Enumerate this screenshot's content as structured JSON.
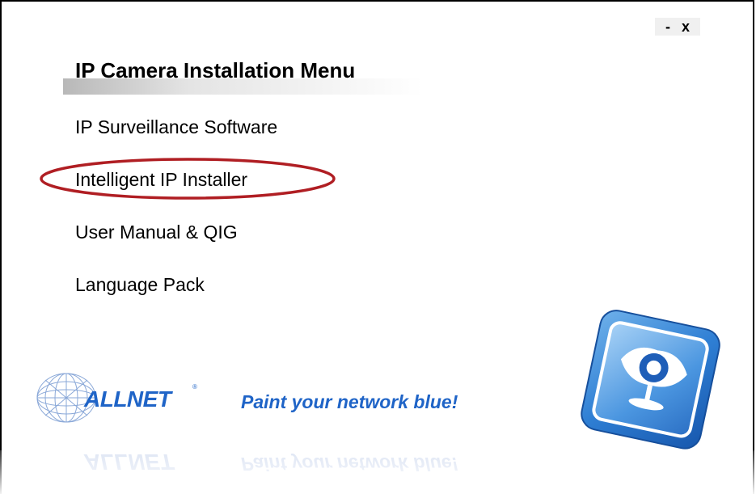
{
  "window": {
    "minimize_label": "-",
    "close_label": "x"
  },
  "menu": {
    "title": "IP Camera Installation Menu",
    "items": [
      {
        "label": "IP Surveillance Software"
      },
      {
        "label": "Intelligent IP Installer",
        "highlighted": true
      },
      {
        "label": "User Manual & QIG"
      },
      {
        "label": "Language Pack"
      }
    ]
  },
  "branding": {
    "logo_text": "ALLNET",
    "logo_mark": "®",
    "slogan": "Paint your network blue!",
    "brand_color": "#1f64c7"
  },
  "highlight_color": "#b01e23",
  "icons": {
    "brand_logo": "globe-wireframe-icon",
    "app_icon": "eye-camera-icon"
  }
}
